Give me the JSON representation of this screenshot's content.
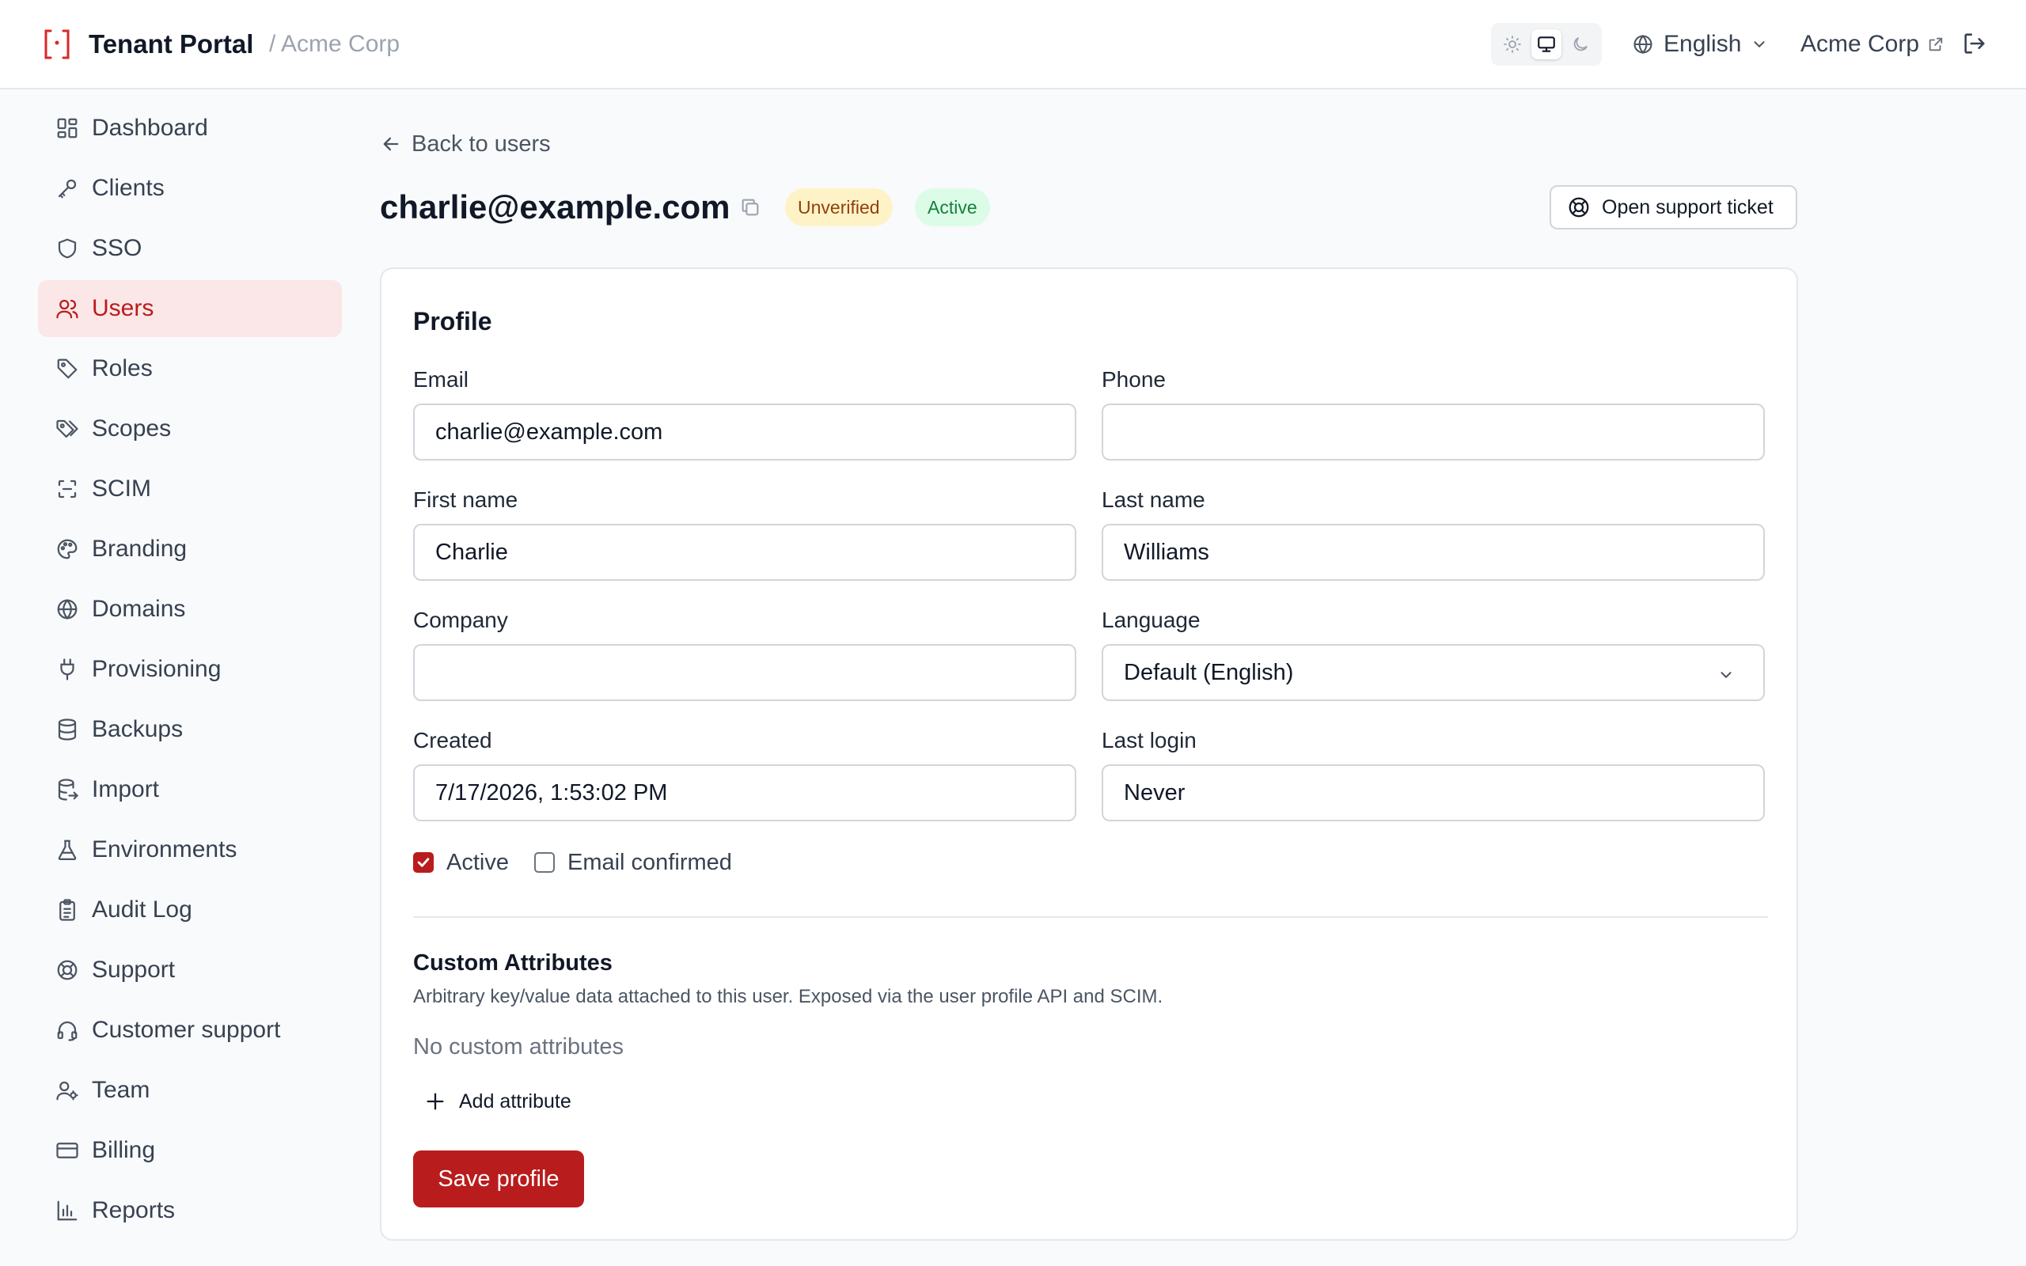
{
  "header": {
    "app_title": "Tenant Portal",
    "breadcrumb": "/ Acme Corp",
    "language": "English",
    "org_link": "Acme Corp"
  },
  "sidebar": {
    "items": [
      {
        "label": "Dashboard",
        "icon": "dashboard-icon"
      },
      {
        "label": "Clients",
        "icon": "key-icon"
      },
      {
        "label": "SSO",
        "icon": "shield-icon"
      },
      {
        "label": "Users",
        "icon": "users-icon",
        "active": true
      },
      {
        "label": "Roles",
        "icon": "tag-icon"
      },
      {
        "label": "Scopes",
        "icon": "tags-icon"
      },
      {
        "label": "SCIM",
        "icon": "scan-icon"
      },
      {
        "label": "Branding",
        "icon": "palette-icon"
      },
      {
        "label": "Domains",
        "icon": "globe-icon"
      },
      {
        "label": "Provisioning",
        "icon": "plug-icon"
      },
      {
        "label": "Backups",
        "icon": "database-icon"
      },
      {
        "label": "Import",
        "icon": "database-import-icon"
      },
      {
        "label": "Environments",
        "icon": "flask-icon"
      },
      {
        "label": "Audit Log",
        "icon": "clipboard-icon"
      },
      {
        "label": "Support",
        "icon": "lifebuoy-icon"
      },
      {
        "label": "Customer support",
        "icon": "headset-icon"
      },
      {
        "label": "Team",
        "icon": "team-icon"
      },
      {
        "label": "Billing",
        "icon": "credit-card-icon"
      },
      {
        "label": "Reports",
        "icon": "bar-chart-icon"
      }
    ]
  },
  "main": {
    "back_label": "Back to users",
    "user_email": "charlie@example.com",
    "badges": {
      "unverified": "Unverified",
      "active": "Active"
    },
    "support_button": "Open support ticket",
    "profile": {
      "title": "Profile",
      "email_label": "Email",
      "email_value": "charlie@example.com",
      "phone_label": "Phone",
      "phone_value": "",
      "first_name_label": "First name",
      "first_name_value": "Charlie",
      "last_name_label": "Last name",
      "last_name_value": "Williams",
      "company_label": "Company",
      "company_value": "",
      "language_label": "Language",
      "language_value": "Default (English)",
      "created_label": "Created",
      "created_value": "7/17/2026, 1:53:02 PM",
      "last_login_label": "Last login",
      "last_login_value": "Never",
      "active_label": "Active",
      "active_checked": true,
      "email_confirmed_label": "Email confirmed",
      "email_confirmed_checked": false
    },
    "custom_attributes": {
      "title": "Custom Attributes",
      "description": "Arbitrary key/value data attached to this user. Exposed via the user profile API and SCIM.",
      "empty_text": "No custom attributes",
      "add_label": "Add attribute"
    },
    "save_label": "Save profile"
  },
  "colors": {
    "accent": "#b91c1c",
    "accent_bg": "#fbe7e8",
    "badge_unverified_bg": "#fef3c7",
    "badge_active_bg": "#dcfce7"
  }
}
